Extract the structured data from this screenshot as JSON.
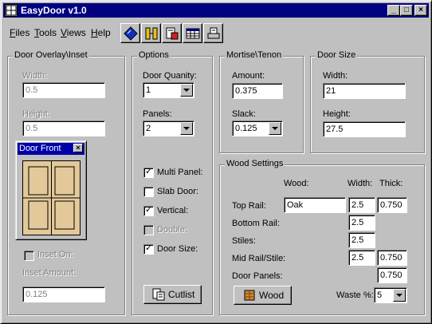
{
  "window": {
    "title": "EasyDoor v1.0"
  },
  "menu": {
    "files": {
      "key": "F",
      "rest": "iles"
    },
    "tools": {
      "key": "T",
      "rest": "ools"
    },
    "views": {
      "key": "V",
      "rest": "iews"
    },
    "help": {
      "key": "H",
      "rest": "elp"
    }
  },
  "toolbar": {
    "icons": [
      "ruler-icon",
      "door-panels-icon",
      "export-icon",
      "table-icon",
      "print-icon"
    ]
  },
  "door_overlay": {
    "title": "Door Overlay\\Inset",
    "width_label": "Width:",
    "width_value": "0.5",
    "height_label": "Height:",
    "height_value": "0.5",
    "inset_on_label": "Inset On:",
    "inset_amount_label": "Inset Amount:",
    "inset_amount_value": "0.125"
  },
  "door_front": {
    "title": "Door Front",
    "close": "×"
  },
  "options": {
    "title": "Options",
    "door_qty_label": "Door Quanity:",
    "door_qty_value": "1",
    "panels_label": "Panels:",
    "panels_value": "2",
    "multi_panel_label": "Multi Panel:",
    "multi_panel_checked": true,
    "slab_door_label": "Slab Door:",
    "slab_door_checked": false,
    "vertical_label": "Vertical:",
    "vertical_checked": true,
    "double_label": "Double:",
    "double_checked": false,
    "door_size_label": "Door Size:",
    "door_size_checked": true,
    "cutlist_label": "Cutlist"
  },
  "mortise": {
    "title": "Mortise\\Tenon",
    "amount_label": "Amount:",
    "amount_value": "0.375",
    "slack_label": "Slack:",
    "slack_value": "0.125"
  },
  "door_size": {
    "title": "Door Size",
    "width_label": "Width:",
    "width_value": "21",
    "height_label": "Height:",
    "height_value": "27.5"
  },
  "wood_settings": {
    "title": "Wood Settings",
    "col_wood": "Wood:",
    "col_width": "Width:",
    "col_thick": "Thick:",
    "top_rail_label": "Top Rail:",
    "top_rail_wood": "Oak",
    "top_rail_width": "2.5",
    "top_rail_thick": "0.750",
    "bottom_rail_label": "Bottom Rail:",
    "bottom_rail_width": "2.5",
    "stiles_label": "Stiles:",
    "stiles_width": "2.5",
    "mid_rail_label": "Mid Rail/Stile:",
    "mid_rail_width": "2.5",
    "mid_rail_thick": "0.750",
    "door_panels_label": "Door Panels:",
    "door_panels_thick": "0.750",
    "wood_button_label": "Wood",
    "waste_label": "Waste %:",
    "waste_value": "5"
  },
  "colors": {
    "title_bar": "#000080",
    "face": "#c0c0c0",
    "door_wood": "#e3c999"
  }
}
